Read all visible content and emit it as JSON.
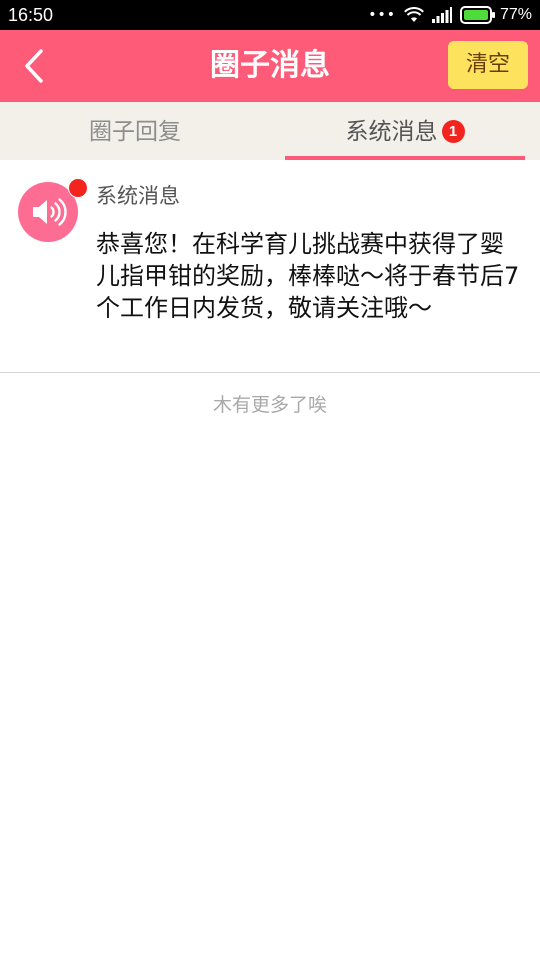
{
  "status_bar": {
    "time": "16:50",
    "battery_percent": "77%",
    "icons": [
      "more-dots-icon",
      "wifi-icon",
      "signal-icon",
      "battery-icon"
    ]
  },
  "header": {
    "title": "圈子消息",
    "clear_label": "清空",
    "back_icon": "chevron-left-icon",
    "colors": {
      "bar": "#fe5b79",
      "clear_button": "#fde35d",
      "clear_text": "#6a3c08"
    }
  },
  "tabs": [
    {
      "label": "圈子回复",
      "selected": false
    },
    {
      "label": "系统消息",
      "selected": true,
      "badge": "1"
    }
  ],
  "messages": [
    {
      "sender": "系统消息",
      "icon": "speaker-icon",
      "unread": true,
      "body": "恭喜您！在科学育儿挑战赛中获得了婴儿指甲钳的奖励，棒棒哒～将于春节后7个工作日内发货，敬请关注哦～"
    }
  ],
  "footer": {
    "no_more": "木有更多了唉"
  }
}
